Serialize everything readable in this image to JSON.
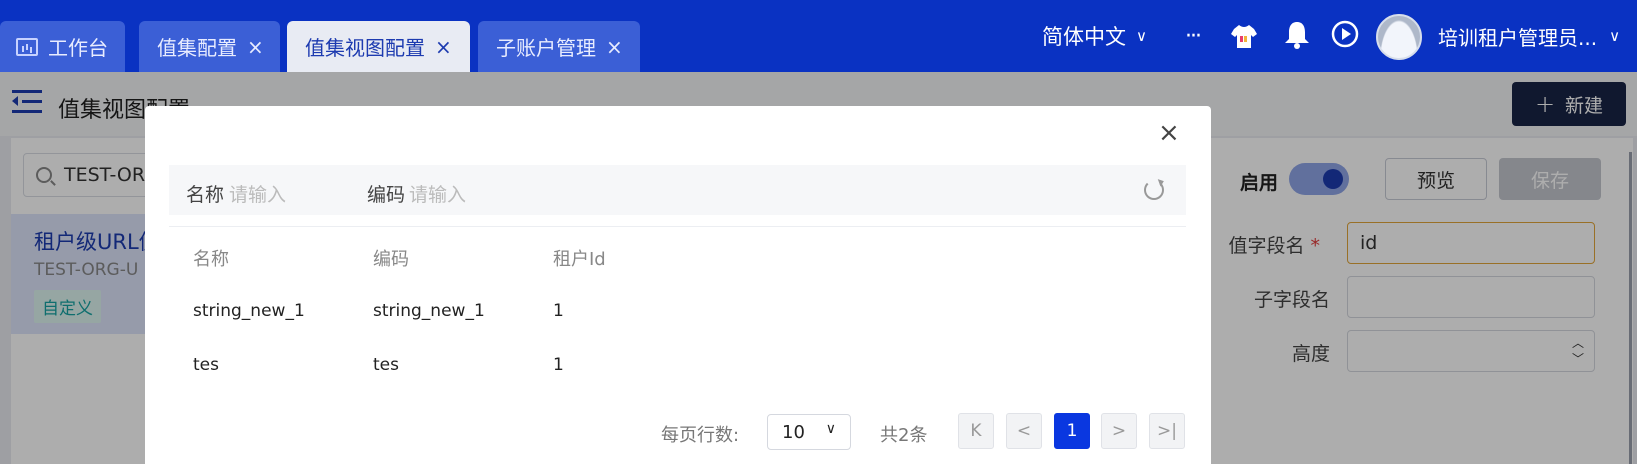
{
  "topbar": {
    "tabs": [
      {
        "label": "工作台",
        "closable": false
      },
      {
        "label": "值集配置",
        "closable": true
      },
      {
        "label": "值集视图配置",
        "closable": true,
        "active": true
      },
      {
        "label": "子账户管理",
        "closable": true
      }
    ],
    "close_glyph": "×",
    "language": "简体中文",
    "more": "···",
    "user_name": "培训租户管理员..."
  },
  "page": {
    "title": "值集视图配置",
    "new_button": "新建"
  },
  "sidebar": {
    "search_value": "TEST-ORG",
    "item": {
      "title": "租户级URL值",
      "code": "TEST-ORG-U",
      "tag": "自定义"
    }
  },
  "form": {
    "enable_label": "启用",
    "enabled": true,
    "preview_button": "预览",
    "save_button": "保存",
    "fields": [
      {
        "label": "值字段名",
        "value": "id",
        "required": true
      },
      {
        "label": "子字段名",
        "value": ""
      },
      {
        "label": "高度",
        "value": ""
      }
    ]
  },
  "modal": {
    "close_glyph": "×",
    "filters": [
      {
        "label": "名称",
        "placeholder": "请输入"
      },
      {
        "label": "编码",
        "placeholder": "请输入"
      }
    ],
    "columns": [
      "名称",
      "编码",
      "租户Id"
    ],
    "rows": [
      [
        "string_new_1",
        "string_new_1",
        "1"
      ],
      [
        "tes",
        "tes",
        "1"
      ]
    ],
    "pagination": {
      "rows_per_page_label": "每页行数:",
      "rows_per_page": "10",
      "total": "共2条",
      "current_page": "1",
      "first": "K",
      "prev": "<",
      "next": ">",
      "last": ">|"
    }
  },
  "colors": {
    "topbar": "#0a32c2",
    "primary": "#1d3bb0",
    "active_page": "#0a37e0",
    "required": "#e23c3c"
  }
}
